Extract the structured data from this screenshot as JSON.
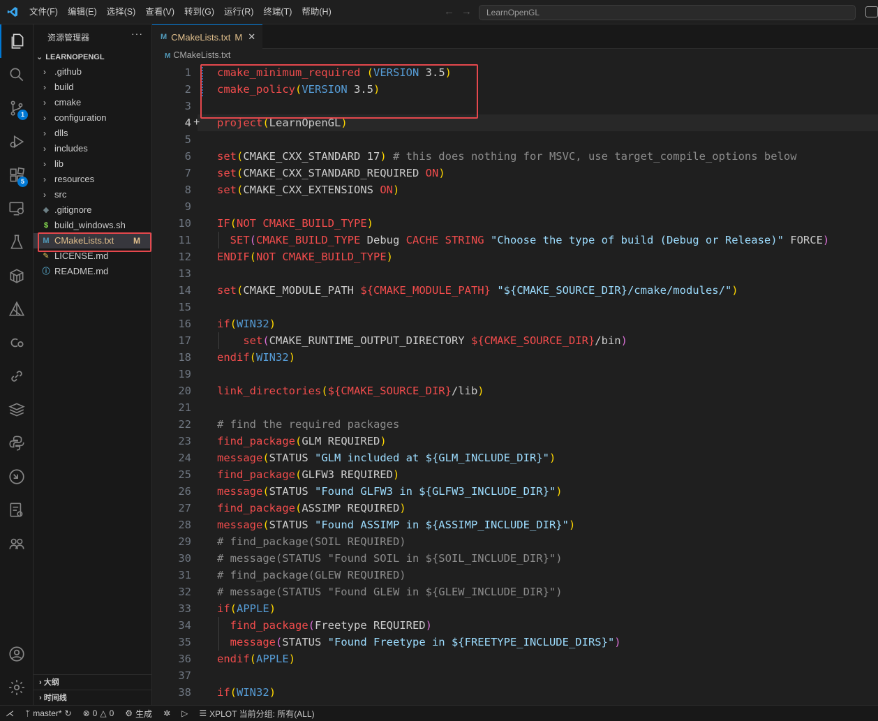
{
  "menu": [
    "文件(F)",
    "编辑(E)",
    "选择(S)",
    "查看(V)",
    "转到(G)",
    "运行(R)",
    "终端(T)",
    "帮助(H)"
  ],
  "search": {
    "text": "LearnOpenGL"
  },
  "activity": {
    "scm_badge": "1",
    "extensions_badge": "5"
  },
  "sidebar": {
    "title": "资源管理器",
    "root": "LEARNOPENGL",
    "folders": [
      ".github",
      "build",
      "cmake",
      "configuration",
      "dlls",
      "includes",
      "lib",
      "resources",
      "src"
    ],
    "files": [
      {
        "name": ".gitignore",
        "icon": "◆",
        "color": "#6d8086"
      },
      {
        "name": "build_windows.sh",
        "icon": "$",
        "color": "#89e051"
      },
      {
        "name": "CMakeLists.txt",
        "icon": "M",
        "color": "#519aba",
        "modified": "M"
      },
      {
        "name": "LICENSE.md",
        "icon": "✎",
        "color": "#e8c95d"
      },
      {
        "name": "README.md",
        "icon": "ⓘ",
        "color": "#519aba"
      }
    ],
    "outline": "大纲",
    "timeline": "时间线"
  },
  "tab": {
    "label": "CMakeLists.txt",
    "modified": "M",
    "icon": "M"
  },
  "breadcrumb": "CMakeLists.txt",
  "code_lines": [
    [
      [
        "fn",
        "cmake_minimum_required"
      ],
      [
        "t",
        " "
      ],
      [
        "p1",
        "("
      ],
      [
        "kw",
        "VERSION"
      ],
      [
        "t",
        " 3.5"
      ],
      [
        "p1",
        ")"
      ]
    ],
    [
      [
        "fn",
        "cmake_policy"
      ],
      [
        "p1",
        "("
      ],
      [
        "kw",
        "VERSION"
      ],
      [
        "t",
        " 3.5"
      ],
      [
        "p1",
        ")"
      ]
    ],
    [],
    [
      [
        "fn",
        "project"
      ],
      [
        "p1",
        "("
      ],
      [
        "t",
        "LearnOpenGL"
      ],
      [
        "p1",
        ")"
      ]
    ],
    [],
    [
      [
        "fn",
        "set"
      ],
      [
        "p1",
        "("
      ],
      [
        "t",
        "CMAKE_CXX_STANDARD 17"
      ],
      [
        "p1",
        ")"
      ],
      [
        "cm",
        " # this does nothing for MSVC, use target_compile_options below"
      ]
    ],
    [
      [
        "fn",
        "set"
      ],
      [
        "p1",
        "("
      ],
      [
        "t",
        "CMAKE_CXX_STANDARD_REQUIRED "
      ],
      [
        "on",
        "ON"
      ],
      [
        "p1",
        ")"
      ]
    ],
    [
      [
        "fn",
        "set"
      ],
      [
        "p1",
        "("
      ],
      [
        "t",
        "CMAKE_CXX_EXTENSIONS "
      ],
      [
        "on",
        "ON"
      ],
      [
        "p1",
        ")"
      ]
    ],
    [],
    [
      [
        "fn",
        "IF"
      ],
      [
        "p1",
        "("
      ],
      [
        "on",
        "NOT"
      ],
      [
        "t",
        " "
      ],
      [
        "on",
        "CMAKE_BUILD_TYPE"
      ],
      [
        "p1",
        ")"
      ]
    ],
    [
      [
        "t",
        "  "
      ],
      [
        "fn",
        "SET"
      ],
      [
        "p2",
        "("
      ],
      [
        "on",
        "CMAKE_BUILD_TYPE"
      ],
      [
        "t",
        " Debug "
      ],
      [
        "on",
        "CACHE STRING"
      ],
      [
        "t",
        " "
      ],
      [
        "str",
        "\"Choose the type of build (Debug or Release)\""
      ],
      [
        "t",
        " FORCE"
      ],
      [
        "p2",
        ")"
      ]
    ],
    [
      [
        "fn",
        "ENDIF"
      ],
      [
        "p1",
        "("
      ],
      [
        "on",
        "NOT"
      ],
      [
        "t",
        " "
      ],
      [
        "on",
        "CMAKE_BUILD_TYPE"
      ],
      [
        "p1",
        ")"
      ]
    ],
    [],
    [
      [
        "fn",
        "set"
      ],
      [
        "p1",
        "("
      ],
      [
        "t",
        "CMAKE_MODULE_PATH "
      ],
      [
        "on",
        "${"
      ],
      [
        "on",
        "CMAKE_MODULE_PATH"
      ],
      [
        "on",
        "}"
      ],
      [
        "t",
        " "
      ],
      [
        "str",
        "\"${CMAKE_SOURCE_DIR}/cmake/modules/\""
      ],
      [
        "p1",
        ")"
      ]
    ],
    [],
    [
      [
        "fn",
        "if"
      ],
      [
        "p1",
        "("
      ],
      [
        "kw",
        "WIN32"
      ],
      [
        "p1",
        ")"
      ]
    ],
    [
      [
        "t",
        "    "
      ],
      [
        "fn",
        "set"
      ],
      [
        "p2",
        "("
      ],
      [
        "t",
        "CMAKE_RUNTIME_OUTPUT_DIRECTORY "
      ],
      [
        "on",
        "${CMAKE_SOURCE_DIR}"
      ],
      [
        "t",
        "/bin"
      ],
      [
        "p2",
        ")"
      ]
    ],
    [
      [
        "fn",
        "endif"
      ],
      [
        "p1",
        "("
      ],
      [
        "kw",
        "WIN32"
      ],
      [
        "p1",
        ")"
      ]
    ],
    [],
    [
      [
        "fn",
        "link_directories"
      ],
      [
        "p1",
        "("
      ],
      [
        "on",
        "${CMAKE_SOURCE_DIR}"
      ],
      [
        "t",
        "/lib"
      ],
      [
        "p1",
        ")"
      ]
    ],
    [],
    [
      [
        "cm",
        "# find the required packages"
      ]
    ],
    [
      [
        "fn",
        "find_package"
      ],
      [
        "p1",
        "("
      ],
      [
        "t",
        "GLM REQUIRED"
      ],
      [
        "p1",
        ")"
      ]
    ],
    [
      [
        "fn",
        "message"
      ],
      [
        "p1",
        "("
      ],
      [
        "t",
        "STATUS "
      ],
      [
        "str",
        "\"GLM included at ${GLM_INCLUDE_DIR}\""
      ],
      [
        "p1",
        ")"
      ]
    ],
    [
      [
        "fn",
        "find_package"
      ],
      [
        "p1",
        "("
      ],
      [
        "t",
        "GLFW3 REQUIRED"
      ],
      [
        "p1",
        ")"
      ]
    ],
    [
      [
        "fn",
        "message"
      ],
      [
        "p1",
        "("
      ],
      [
        "t",
        "STATUS "
      ],
      [
        "str",
        "\"Found GLFW3 in ${GLFW3_INCLUDE_DIR}\""
      ],
      [
        "p1",
        ")"
      ]
    ],
    [
      [
        "fn",
        "find_package"
      ],
      [
        "p1",
        "("
      ],
      [
        "t",
        "ASSIMP REQUIRED"
      ],
      [
        "p1",
        ")"
      ]
    ],
    [
      [
        "fn",
        "message"
      ],
      [
        "p1",
        "("
      ],
      [
        "t",
        "STATUS "
      ],
      [
        "str",
        "\"Found ASSIMP in ${ASSIMP_INCLUDE_DIR}\""
      ],
      [
        "p1",
        ")"
      ]
    ],
    [
      [
        "cm",
        "# find_package(SOIL REQUIRED)"
      ]
    ],
    [
      [
        "cm",
        "# message(STATUS \"Found SOIL in ${SOIL_INCLUDE_DIR}\")"
      ]
    ],
    [
      [
        "cm",
        "# find_package(GLEW REQUIRED)"
      ]
    ],
    [
      [
        "cm",
        "# message(STATUS \"Found GLEW in ${GLEW_INCLUDE_DIR}\")"
      ]
    ],
    [
      [
        "fn",
        "if"
      ],
      [
        "p1",
        "("
      ],
      [
        "kw",
        "APPLE"
      ],
      [
        "p1",
        ")"
      ]
    ],
    [
      [
        "t",
        "  "
      ],
      [
        "fn",
        "find_package"
      ],
      [
        "p2",
        "("
      ],
      [
        "t",
        "Freetype REQUIRED"
      ],
      [
        "p2",
        ")"
      ]
    ],
    [
      [
        "t",
        "  "
      ],
      [
        "fn",
        "message"
      ],
      [
        "p2",
        "("
      ],
      [
        "t",
        "STATUS "
      ],
      [
        "str",
        "\"Found Freetype in ${FREETYPE_INCLUDE_DIRS}\""
      ],
      [
        "p2",
        ")"
      ]
    ],
    [
      [
        "fn",
        "endif"
      ],
      [
        "p1",
        "("
      ],
      [
        "kw",
        "APPLE"
      ],
      [
        "p1",
        ")"
      ]
    ],
    [],
    [
      [
        "fn",
        "if"
      ],
      [
        "p1",
        "("
      ],
      [
        "kw",
        "WIN32"
      ],
      [
        "p1",
        ")"
      ]
    ]
  ],
  "status": {
    "branch": "master*",
    "errors": "0",
    "warnings": "0",
    "build": "生成",
    "xplot": "XPLOT 当前分组: 所有(ALL)"
  }
}
